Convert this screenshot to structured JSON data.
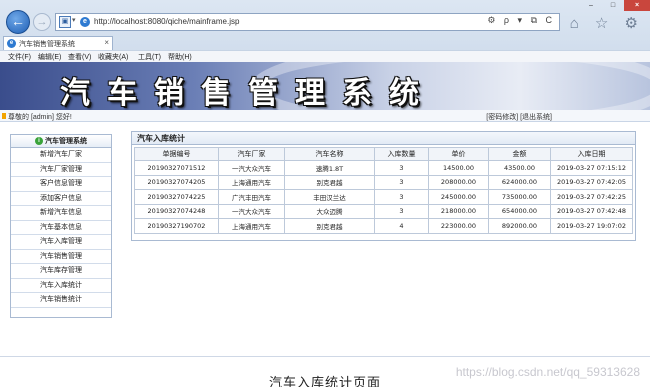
{
  "browser": {
    "url": "http://localhost:8080/qiche/mainframe.jsp",
    "tab_title": "汽车销售管理系统",
    "tab_close": "×",
    "window_buttons": {
      "min": "–",
      "max": "□",
      "close": "×"
    },
    "addr_tools": "⚙ ρ ▾ ⧉ C",
    "tool_icons": "⌂ ☆ ⚙",
    "menu": [
      "文件(F)",
      "编辑(E)",
      "查看(V)",
      "收藏夹(A)",
      "工具(T)",
      "帮助(H)"
    ]
  },
  "banner": {
    "title": "汽车销售管理系统"
  },
  "status": {
    "welcome": "尊敬的 [admin] 您好!",
    "links": "[密码修改] [退出系统]"
  },
  "sidebar": {
    "header": "汽车管理系统",
    "items": [
      "新增汽车厂家",
      "汽车厂家管理",
      "客户信息管理",
      "添加客户信息",
      "新增汽车信息",
      "汽车基本信息",
      "汽车入库管理",
      "汽车销售管理",
      "汽车库存管理",
      "汽车入库统计",
      "汽车销售统计"
    ]
  },
  "main": {
    "title": "汽车入库统计",
    "columns": [
      "单据编号",
      "汽车厂家",
      "汽车名称",
      "入库数量",
      "单价",
      "金额",
      "入库日期"
    ],
    "rows": [
      [
        "20190327071512",
        "一汽大众汽车",
        "速腾1.8T",
        "3",
        "14500.00",
        "43500.00",
        "2019-03-27 07:15:12"
      ],
      [
        "20190327074205",
        "上海通用汽车",
        "别克君越",
        "3",
        "208000.00",
        "624000.00",
        "2019-03-27 07:42:05"
      ],
      [
        "20190327074225",
        "广汽丰田汽车",
        "丰田汉兰达",
        "3",
        "245000.00",
        "735000.00",
        "2019-03-27 07:42:25"
      ],
      [
        "20190327074248",
        "一汽大众汽车",
        "大众迈腾",
        "3",
        "218000.00",
        "654000.00",
        "2019-03-27 07:42:48"
      ],
      [
        "20190327190702",
        "上海通用汽车",
        "别克君越",
        "4",
        "223000.00",
        "892000.00",
        "2019-03-27 19:07:02"
      ]
    ]
  },
  "caption": "汽车入库统计页面",
  "watermark": "https://blog.csdn.net/qq_59313628"
}
